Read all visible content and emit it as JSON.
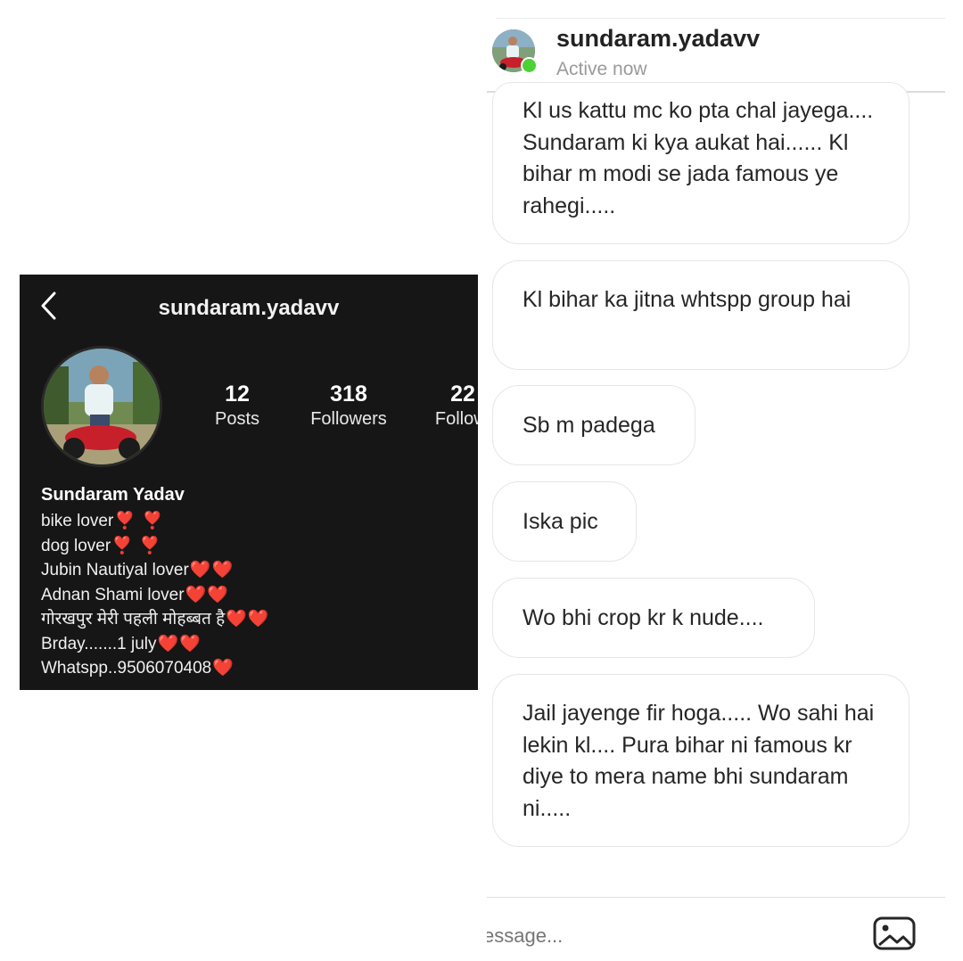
{
  "profile": {
    "username": "sundaram.yadavv",
    "stats": [
      {
        "value": "12",
        "label": "Posts"
      },
      {
        "value": "318",
        "label": "Followers"
      },
      {
        "value": "22",
        "label": "Followi"
      }
    ],
    "bio": {
      "name": "Sundaram Yadav",
      "lines": [
        {
          "text": "bike lover",
          "emoji": "❣️ ❣️"
        },
        {
          "text": "dog lover",
          "emoji": "❣️ ❣️"
        },
        {
          "text": "Jubin Nautiyal lover",
          "emoji": "❤️❤️"
        },
        {
          "text": "Adnan Shami lover",
          "emoji": "❤️❤️"
        },
        {
          "text": "गोरखपुर मेरी पहली मोहब्बत है",
          "emoji": "❤️❤️"
        },
        {
          "text": "Brday.......1 july",
          "emoji": "❤️❤️"
        },
        {
          "text": "Whatspp..9506070408",
          "emoji": "❤️"
        }
      ]
    }
  },
  "dm": {
    "username": "sundaram.yadavv",
    "status": "Active now",
    "messages": [
      "Kl us kattu mc ko pta chal jayega.... Sundaram ki kya aukat hai...... Kl bihar m modi se jada famous ye rahegi.....",
      "Kl bihar ka jitna whtspp group hai",
      "Sb m padega",
      "Iska pic",
      "Wo bhi crop kr k nude....",
      "Jail jayenge fir hoga..... Wo sahi hai lekin kl.... Pura bihar ni famous kr diye to mera name bhi sundaram ni....."
    ],
    "composer_placeholder": "essage..."
  },
  "colors": {
    "profile_background": "#161616",
    "online_indicator": "#4cd137",
    "heart": "#ff2a2a"
  },
  "icons": [
    "chevron-left-icon",
    "online-indicator",
    "image-gallery-icon"
  ]
}
